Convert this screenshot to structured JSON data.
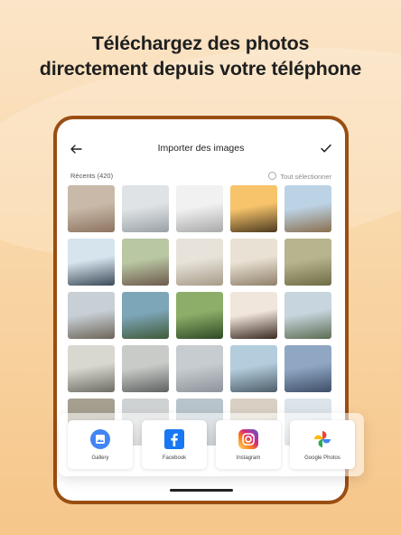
{
  "headline": {
    "line1": "Téléchargez des photos",
    "line2": "directement depuis votre téléphone"
  },
  "app": {
    "title": "Importer des images",
    "back_icon": "arrow-left-icon",
    "confirm_icon": "check-icon",
    "recent_label": "Récents (420)",
    "select_all_label": "Tout sélectionner"
  },
  "thumbnails": [
    {
      "desc": "table-flowers",
      "colors": [
        "#c9b9a8",
        "#8c7460"
      ]
    },
    {
      "desc": "seagulls-sky",
      "colors": [
        "#dfe3e6",
        "#9aa1a6"
      ]
    },
    {
      "desc": "pier-sea",
      "colors": [
        "#f1f1f1",
        "#a9a9a9"
      ]
    },
    {
      "desc": "sunset-lake",
      "colors": [
        "#f7c46b",
        "#4d3a20"
      ]
    },
    {
      "desc": "swing-sky",
      "colors": [
        "#bcd3e6",
        "#8a6f4e"
      ]
    },
    {
      "desc": "cyclist-harbor",
      "colors": [
        "#d6e4ee",
        "#3c4b58"
      ]
    },
    {
      "desc": "picnic-friends",
      "colors": [
        "#b9c7a3",
        "#6d5a4c"
      ]
    },
    {
      "desc": "cafe-table",
      "colors": [
        "#e7e3da",
        "#a89b88"
      ]
    },
    {
      "desc": "terrace-tables",
      "colors": [
        "#e9e1d3",
        "#8f806b"
      ]
    },
    {
      "desc": "olive-tree",
      "colors": [
        "#b8b48e",
        "#6f6b45"
      ]
    },
    {
      "desc": "wooden-pier",
      "colors": [
        "#c8d0d6",
        "#6d6559"
      ]
    },
    {
      "desc": "coast-cove",
      "colors": [
        "#7ea6b9",
        "#3f5a39"
      ]
    },
    {
      "desc": "forest-path",
      "colors": [
        "#8dae69",
        "#2f4a25"
      ]
    },
    {
      "desc": "woman-portrait",
      "colors": [
        "#f1e6dc",
        "#3a2a22"
      ]
    },
    {
      "desc": "beach-photographer",
      "colors": [
        "#c7d5de",
        "#5d6d52"
      ]
    },
    {
      "desc": "sea-horizon",
      "colors": [
        "#d9d8d0",
        "#6d6d66"
      ]
    },
    {
      "desc": "sea-dusk",
      "colors": [
        "#c8cbc8",
        "#5f6260"
      ]
    },
    {
      "desc": "calm-sea",
      "colors": [
        "#c6ccd0",
        "#8d949a"
      ]
    },
    {
      "desc": "cyclists-beach",
      "colors": [
        "#b3cddd",
        "#4f5e69"
      ]
    },
    {
      "desc": "friends-beach",
      "colors": [
        "#90a7c4",
        "#3e4e67"
      ]
    },
    {
      "desc": "shore-dark",
      "colors": [
        "#a59f90",
        "#5f574a"
      ]
    },
    {
      "desc": "sand-grey",
      "colors": [
        "#cfd2d3",
        "#9a9d9e"
      ]
    },
    {
      "desc": "ocean-wide",
      "colors": [
        "#b8c4cc",
        "#7c8891"
      ]
    },
    {
      "desc": "terrace-wall",
      "colors": [
        "#d9d0c3",
        "#8e7f68"
      ]
    },
    {
      "desc": "sky-pale",
      "colors": [
        "#dbe4ea",
        "#a5b1b9"
      ]
    }
  ],
  "share_options": [
    {
      "label": "Gallery",
      "icon": "gallery-icon",
      "color": "#3b82f6"
    },
    {
      "label": "Facebook",
      "icon": "facebook-icon",
      "color": "#1877f2"
    },
    {
      "label": "Instagram",
      "icon": "instagram-icon",
      "color": "#e1306c"
    },
    {
      "label": "Google Photos",
      "icon": "google-photos-icon",
      "color": "#34a853"
    }
  ],
  "colors": {
    "accent": "#9a4e12",
    "background_top": "#fbe5c8",
    "background_bottom": "#f6c68a"
  }
}
